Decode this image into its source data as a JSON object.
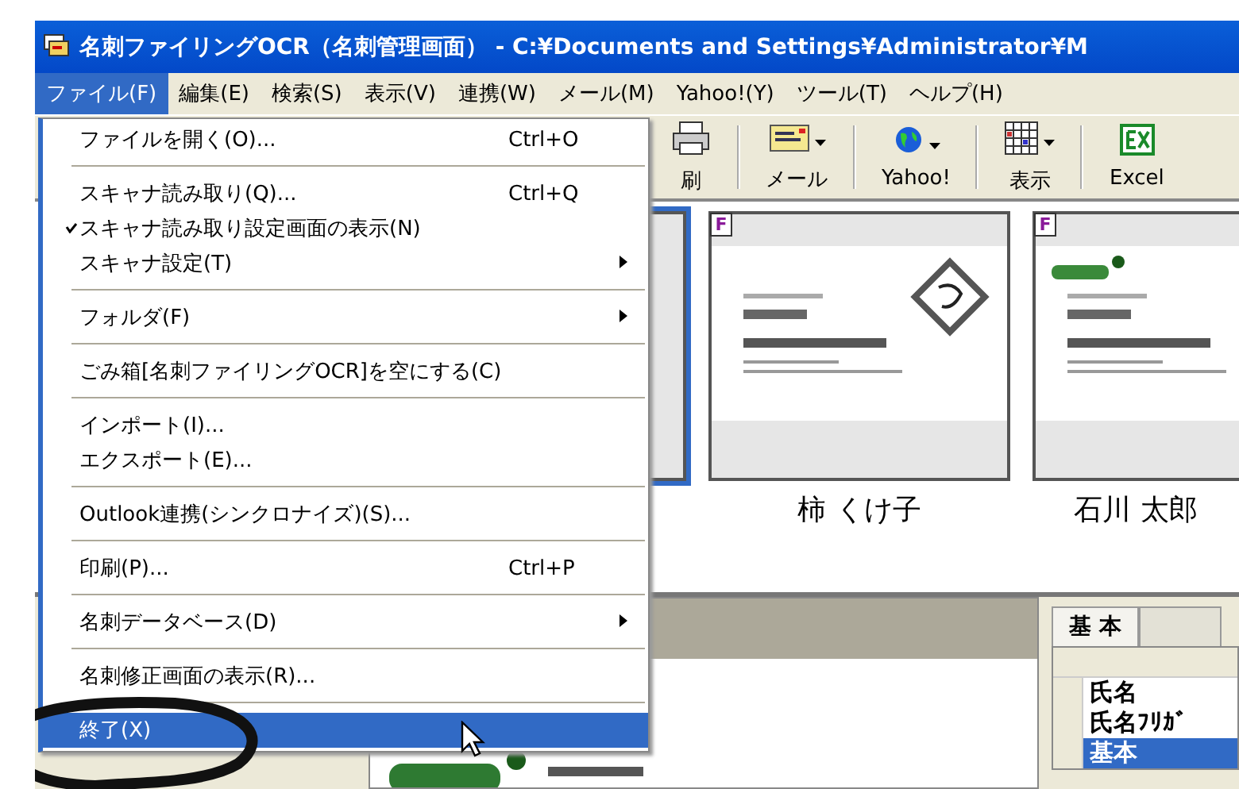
{
  "window": {
    "title": "名刺ファイリングOCR（名刺管理画面） - C:¥Documents and Settings¥Administrator¥M"
  },
  "menubar": [
    {
      "label": "ファイル(F)",
      "selected": true
    },
    {
      "label": "編集(E)",
      "selected": false
    },
    {
      "label": "検索(S)",
      "selected": false
    },
    {
      "label": "表示(V)",
      "selected": false
    },
    {
      "label": "連携(W)",
      "selected": false
    },
    {
      "label": "メール(M)",
      "selected": false
    },
    {
      "label": "Yahoo!(Y)",
      "selected": false
    },
    {
      "label": "ツール(T)",
      "selected": false
    },
    {
      "label": "ヘルプ(H)",
      "selected": false
    }
  ],
  "file_menu": [
    {
      "kind": "item",
      "label": "ファイルを開く(O)...",
      "shortcut": "Ctrl+O",
      "checked": false,
      "submenu": false,
      "selected": false
    },
    {
      "kind": "separator"
    },
    {
      "kind": "item",
      "label": "スキャナ読み取り(Q)...",
      "shortcut": "Ctrl+Q",
      "checked": false,
      "submenu": false,
      "selected": false
    },
    {
      "kind": "item",
      "label": "スキャナ読み取り設定画面の表示(N)",
      "checked": true,
      "submenu": false,
      "selected": false
    },
    {
      "kind": "item",
      "label": "スキャナ設定(T)",
      "checked": false,
      "submenu": true,
      "selected": false
    },
    {
      "kind": "separator"
    },
    {
      "kind": "item",
      "label": "フォルダ(F)",
      "checked": false,
      "submenu": true,
      "selected": false
    },
    {
      "kind": "separator"
    },
    {
      "kind": "item",
      "label": "ごみ箱[名刺ファイリングOCR]を空にする(C)",
      "checked": false,
      "submenu": false,
      "selected": false
    },
    {
      "kind": "separator"
    },
    {
      "kind": "item",
      "label": "インポート(I)...",
      "checked": false,
      "submenu": false,
      "selected": false
    },
    {
      "kind": "item",
      "label": "エクスポート(E)...",
      "checked": false,
      "submenu": false,
      "selected": false
    },
    {
      "kind": "separator"
    },
    {
      "kind": "item",
      "label": "Outlook連携(シンクロナイズ)(S)...",
      "checked": false,
      "submenu": false,
      "selected": false
    },
    {
      "kind": "separator"
    },
    {
      "kind": "item",
      "label": "印刷(P)...",
      "shortcut": "Ctrl+P",
      "checked": false,
      "submenu": false,
      "selected": false
    },
    {
      "kind": "separator"
    },
    {
      "kind": "item",
      "label": "名刺データベース(D)",
      "checked": false,
      "submenu": true,
      "selected": false
    },
    {
      "kind": "separator"
    },
    {
      "kind": "item",
      "label": "名刺修正画面の表示(R)...",
      "checked": false,
      "submenu": false,
      "selected": false
    },
    {
      "kind": "separator"
    },
    {
      "kind": "item",
      "label": "終了(X)",
      "checked": false,
      "submenu": false,
      "selected": true
    }
  ],
  "toolbar": [
    {
      "kind": "print",
      "label": "刷"
    },
    {
      "kind": "mail",
      "label": "メール",
      "dropdown": true
    },
    {
      "kind": "globe",
      "label": "Yahoo!",
      "dropdown": true
    },
    {
      "kind": "grid",
      "label": "表示",
      "dropdown": true
    },
    {
      "kind": "excel",
      "label": "Excel"
    }
  ],
  "cards": [
    {
      "selected": true
    },
    {
      "selected": false,
      "badge": "F",
      "name": "柿 くけ子",
      "kind": "picture"
    },
    {
      "selected": false,
      "badge": "F",
      "name": "石川 太郎",
      "kind": "picture"
    }
  ],
  "detail_tabs": [
    {
      "label": "基 本",
      "selected": true
    },
    {
      "selected": false
    }
  ],
  "fields": [
    {
      "label": "氏名",
      "selected": false
    },
    {
      "label": "氏名ﾌﾘｶﾞ",
      "selected": false
    },
    {
      "label": "基本",
      "selected": true
    }
  ]
}
